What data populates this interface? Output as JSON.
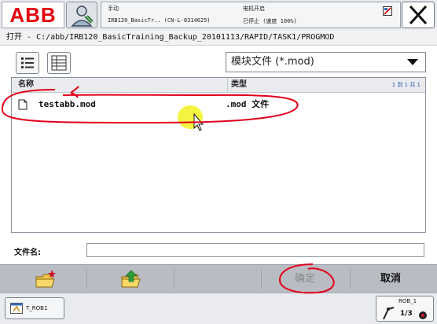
{
  "header": {
    "logo_text": "ABB",
    "mode": "手动",
    "controller": "IRB120_BasicTr.. (CN-L-0314625)",
    "motor_state": "电机开启",
    "run_state": "已停止 (速度 100%)"
  },
  "path": {
    "label": "打开",
    "value": "C:/abb/IRB120_BasicTraining_Backup_20101113/RAPID/TASK1/PROGMOD"
  },
  "filter": {
    "selected": "模块文件 (*.mod)"
  },
  "file_list": {
    "columns": [
      "名称",
      "类型"
    ],
    "pager": "1 到 1 共 1",
    "rows": [
      {
        "name": "testabb.mod",
        "type": ".mod 文件"
      }
    ]
  },
  "filename": {
    "label": "文件名:",
    "value": ""
  },
  "commands": {
    "ok": "确定",
    "cancel": "取消"
  },
  "taskbar": {
    "task": "T_ROB1",
    "rob_label": "ROB_1",
    "rob_sub": "1/3"
  },
  "colors": {
    "abb_red": "#e3000f",
    "annotation_red": "#e1001b",
    "cursor_yellow": "#f0f000"
  },
  "icons": {
    "new_folder": "new-folder-icon",
    "up_folder": "folder-up-icon",
    "list_view": "list-view-icon",
    "detail_view": "detail-view-icon",
    "close": "close-icon",
    "dropdown": "dropdown-arrow-icon",
    "file": "file-icon"
  }
}
